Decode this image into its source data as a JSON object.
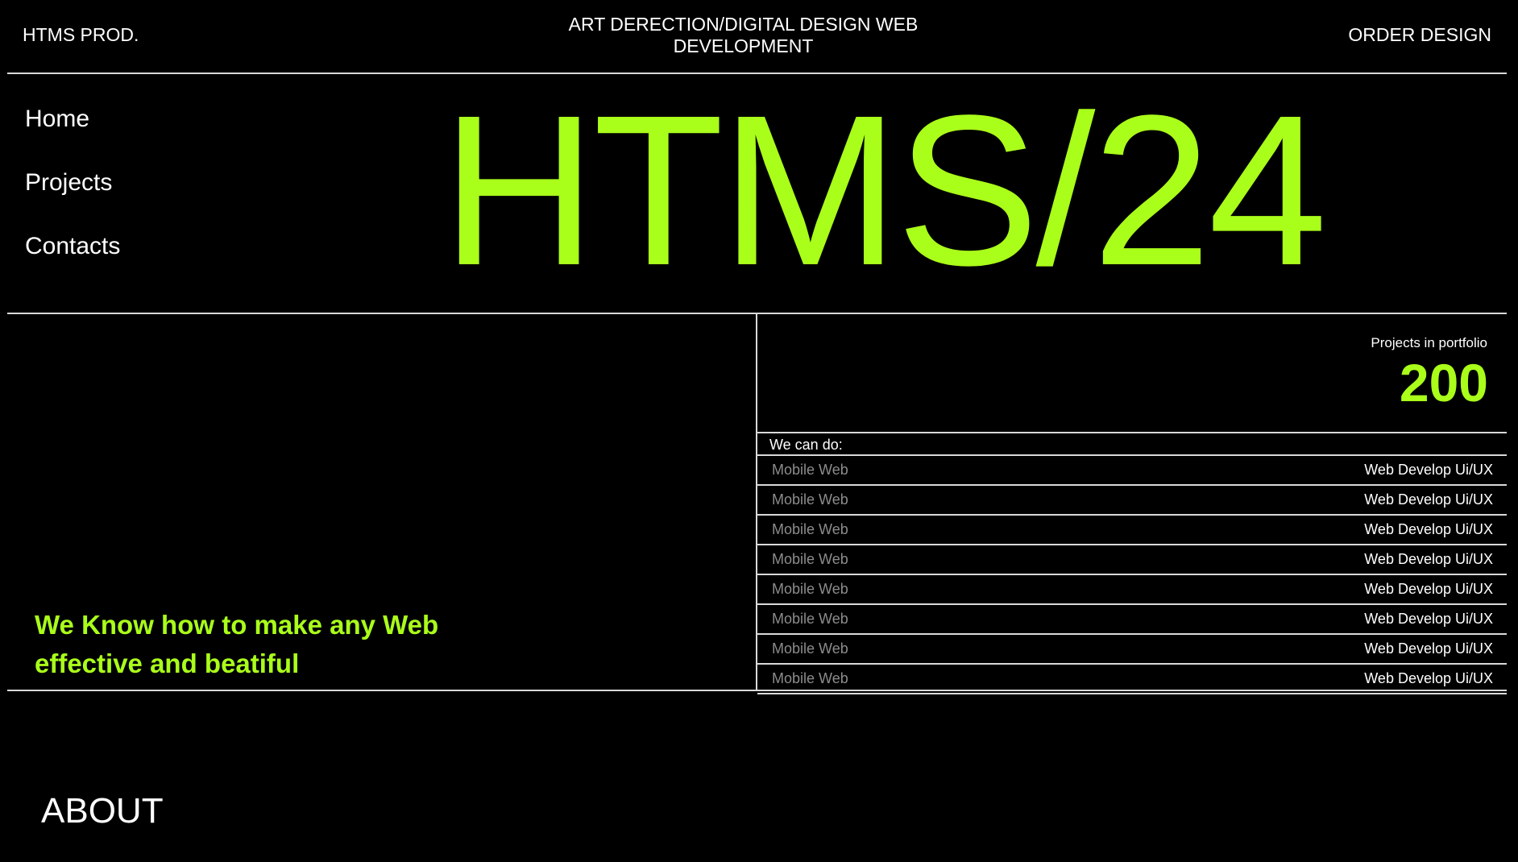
{
  "header": {
    "brand": "HTMS PROD.",
    "tagline": "ART DERECTION/DIGITAL DESIGN WEB DEVELOPMENT",
    "order_button": "ORDER DESIGN"
  },
  "nav": {
    "items": [
      {
        "label": "Home"
      },
      {
        "label": "Projects"
      },
      {
        "label": "Contacts"
      }
    ]
  },
  "hero": {
    "title": "HTMS/24"
  },
  "stats": {
    "label": "Projects in portfolio",
    "value": "200"
  },
  "services": {
    "heading": "We can do:",
    "rows": [
      {
        "left": "Mobile Web",
        "right": "Web Develop Ui/UX"
      },
      {
        "left": "Mobile Web",
        "right": "Web Develop Ui/UX"
      },
      {
        "left": "Mobile Web",
        "right": "Web Develop Ui/UX"
      },
      {
        "left": "Mobile Web",
        "right": "Web Develop Ui/UX"
      },
      {
        "left": "Mobile Web",
        "right": "Web Develop Ui/UX"
      },
      {
        "left": "Mobile Web",
        "right": "Web Develop Ui/UX"
      },
      {
        "left": "Mobile Web",
        "right": "Web Develop Ui/UX"
      },
      {
        "left": "Mobile Web",
        "right": "Web Develop Ui/UX"
      }
    ]
  },
  "slogan": "We Know how to make any Web effective and beatiful",
  "about": {
    "heading": "ABOUT"
  },
  "colors": {
    "background": "#000000",
    "accent": "#aaff1a",
    "text": "#ffffff",
    "muted": "#8c8c8c",
    "divider": "#d9d9d9"
  }
}
